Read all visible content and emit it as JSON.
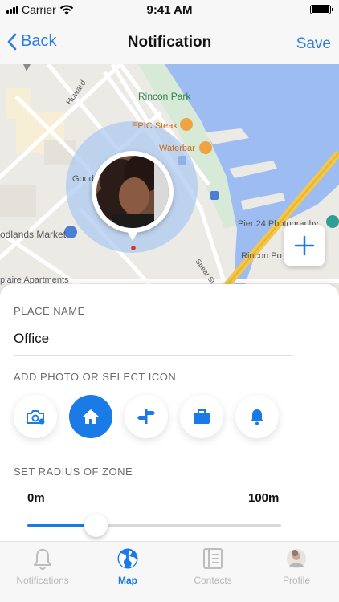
{
  "status_bar": {
    "carrier": "Carrier",
    "time": "9:41 AM"
  },
  "nav": {
    "back_label": "Back",
    "title": "Notification",
    "save_label": "Save"
  },
  "map": {
    "labels": {
      "street_1": "Howard",
      "park": "Rincon Park",
      "restaurant_1": "EPIC Steak",
      "restaurant_2": "Waterbar",
      "poi_1": "Good",
      "market": "odlands Market",
      "pier": "Pier 24 Photography",
      "rincon": "Rincon Po",
      "street_2": "Spear St",
      "apartments": "plaire Apartments"
    },
    "zone_color": "#a9c8f0",
    "water_color": "#9dbcf2"
  },
  "sheet": {
    "place_name_label": "PLACE NAME",
    "place_name_value": "Office",
    "icon_section_label": "ADD PHOTO OR SELECT ICON",
    "icons": [
      "camera-icon",
      "home-icon",
      "signpost-icon",
      "briefcase-icon",
      "bell-icon"
    ],
    "selected_icon": "home-icon",
    "radius_label": "SET RADIUS OF ZONE",
    "radius_min": "0m",
    "radius_max": "100m",
    "radius_fraction": 0.27
  },
  "tabs": [
    {
      "label": "Notifications",
      "icon": "bell-icon",
      "active": false
    },
    {
      "label": "Map",
      "icon": "globe-icon",
      "active": true
    },
    {
      "label": "Contacts",
      "icon": "contacts-icon",
      "active": false
    },
    {
      "label": "Profile",
      "icon": "avatar-icon",
      "active": false
    }
  ],
  "accent_color": "#1a7ae6"
}
